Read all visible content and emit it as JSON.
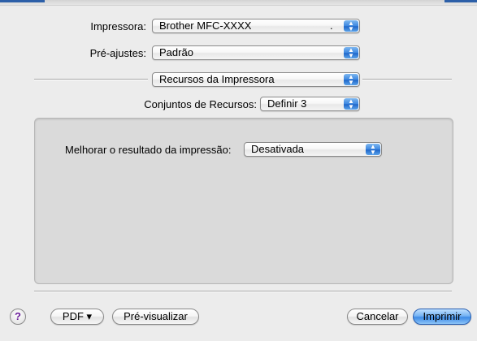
{
  "printer": {
    "label": "Impressora:",
    "value": "Brother MFC-XXXX"
  },
  "presets": {
    "label": "Pré-ajustes:",
    "value": "Padrão"
  },
  "section_popup": {
    "value": "Recursos da Impressora"
  },
  "feature_sets": {
    "label": "Conjuntos de Recursos:",
    "value": "Definir 3"
  },
  "improve_print": {
    "label": "Melhorar o resultado da impressão:",
    "value": "Desativada"
  },
  "buttons": {
    "help": "?",
    "pdf": "PDF ▾",
    "preview": "Pré-visualizar",
    "cancel": "Cancelar",
    "print": "Imprimir"
  },
  "icons": {
    "popup_arrow": "up-down-arrows-icon",
    "help": "question-mark-icon"
  },
  "colors": {
    "accent_blue": "#3d8be6",
    "window_bg": "#ececec",
    "group_bg": "#dadada",
    "help_mark": "#6a1c9a"
  }
}
